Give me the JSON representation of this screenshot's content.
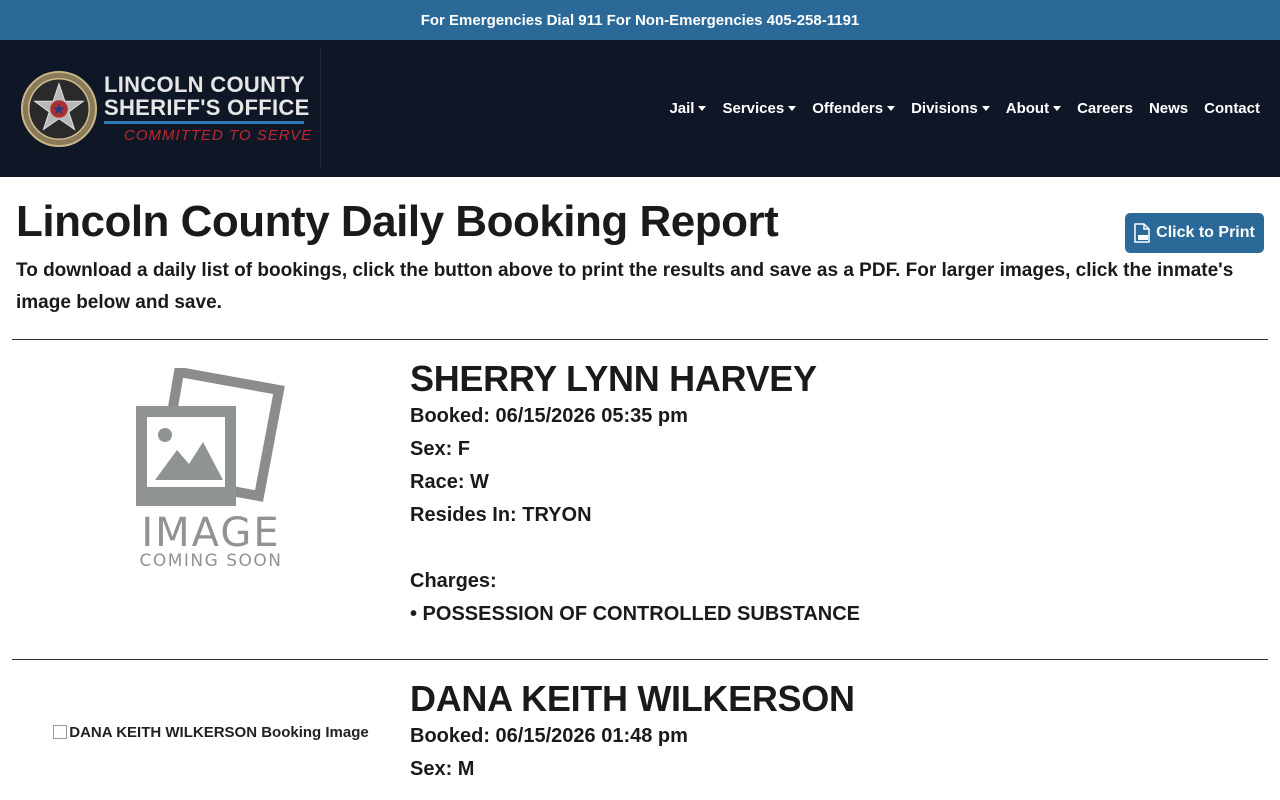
{
  "topbar": {
    "text": "For Emergencies Dial 911 For Non-Emergencies 405-258-1191"
  },
  "logo": {
    "line1": "LINCOLN COUNTY",
    "line2": "SHERIFF'S OFFICE",
    "motto": "COMMITTED TO SERVE",
    "badge_icon": "sheriff-star-badge-icon"
  },
  "nav": {
    "items": [
      {
        "label": "Jail",
        "dropdown": true
      },
      {
        "label": "Services",
        "dropdown": true
      },
      {
        "label": "Offenders",
        "dropdown": true
      },
      {
        "label": "Divisions",
        "dropdown": true
      },
      {
        "label": "About",
        "dropdown": true
      },
      {
        "label": "Careers",
        "dropdown": false
      },
      {
        "label": "News",
        "dropdown": false
      },
      {
        "label": "Contact",
        "dropdown": false
      }
    ]
  },
  "page": {
    "title": "Lincoln County Daily Booking Report",
    "print_label": "Click to Print",
    "intro": "To download a daily list of bookings, click the button above to print the results and save as a PDF. For larger images, click the inmate's image below and save."
  },
  "records": [
    {
      "name": "SHERRY LYNN HARVEY",
      "booked": "Booked: 06/15/2026 05:35 pm",
      "sex": "Sex: F",
      "race": "Race: W",
      "resides": "Resides In: TRYON",
      "charges_label": "Charges:",
      "charges": [
        "• POSSESSION OF CONTROLLED SUBSTANCE"
      ],
      "image_placeholder": {
        "line1": "IMAGE",
        "line2": "COMING SOON"
      }
    },
    {
      "name": "DANA KEITH WILKERSON",
      "booked": "Booked: 06/15/2026 01:48 pm",
      "sex": "Sex: M",
      "image_alt": "DANA KEITH WILKERSON Booking Image"
    }
  ],
  "colors": {
    "topbar": "#2b6a98",
    "header": "#0f1727",
    "button": "#2b6a98",
    "motto": "#c0272d"
  }
}
